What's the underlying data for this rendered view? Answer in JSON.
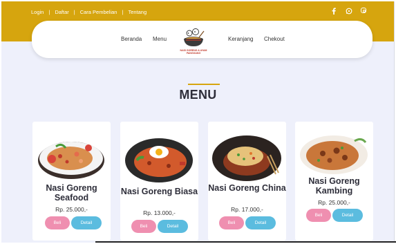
{
  "topbar": {
    "links": [
      "Login",
      "Daftar",
      "Cara Pembelian",
      "Tentang"
    ],
    "separator": "|",
    "social_icons": [
      "facebook-icon",
      "whatsapp-icon",
      "instagram-icon"
    ],
    "color": "#d6a50e"
  },
  "nav": {
    "items": [
      "Beranda",
      "Menu",
      "Keranjang",
      "Chekout"
    ],
    "logo_text": "NASI GORENG & AYAM PANGGANG"
  },
  "main": {
    "title": "MENU"
  },
  "menu": [
    {
      "name": "Nasi Goreng Seafood",
      "price": "Rp. 25.000,-",
      "buy_label": "Beli",
      "detail_label": "Detail"
    },
    {
      "name": "Nasi Goreng Biasa",
      "price": "Rp. 13.000,-",
      "buy_label": "Beli",
      "detail_label": "Detail"
    },
    {
      "name": "Nasi Goreng China",
      "price": "Rp. 17.000,-",
      "buy_label": "Beli",
      "detail_label": "Detail"
    },
    {
      "name": "Nasi Goreng Kambing",
      "price": "Rp. 25.000,-",
      "buy_label": "Beli",
      "detail_label": "Detail"
    }
  ],
  "colors": {
    "accent": "#d6a50e",
    "beli": "#ef8fb0",
    "detail": "#5bbcdf"
  }
}
